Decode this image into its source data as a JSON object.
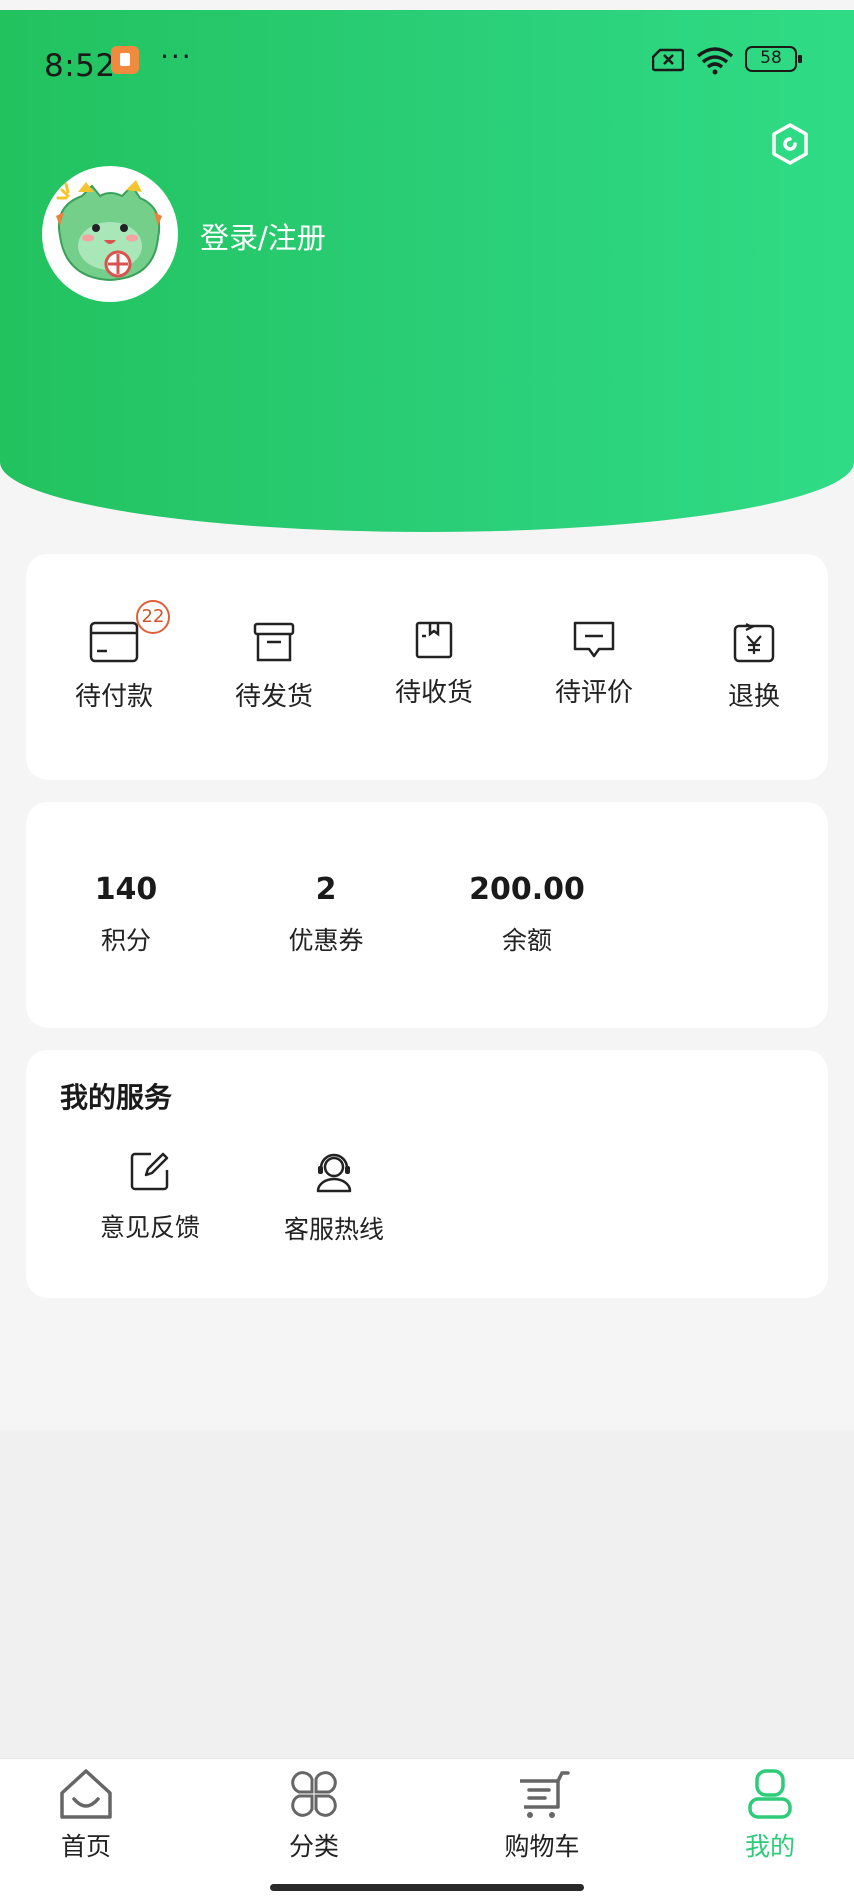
{
  "status_bar": {
    "time": "8:52",
    "battery": "58"
  },
  "header": {
    "login_label": "登录/注册"
  },
  "orders": [
    {
      "label": "待付款",
      "badge": "22",
      "icon": "wallet-card-icon"
    },
    {
      "label": "待发货",
      "icon": "box-icon"
    },
    {
      "label": "待收货",
      "icon": "package-icon"
    },
    {
      "label": "待评价",
      "icon": "comment-icon"
    },
    {
      "label": "退换",
      "icon": "refund-yen-icon"
    }
  ],
  "assets": [
    {
      "value": "140",
      "label": "积分"
    },
    {
      "value": "2",
      "label": "优惠券"
    },
    {
      "value": "200.00",
      "label": "余额"
    }
  ],
  "services": {
    "title": "我的服务",
    "items": [
      {
        "label": "意见反馈",
        "icon": "edit-feedback-icon"
      },
      {
        "label": "客服热线",
        "icon": "customer-service-icon"
      }
    ]
  },
  "tabbar": {
    "items": [
      {
        "label": "首页",
        "icon": "home-icon"
      },
      {
        "label": "分类",
        "icon": "category-icon"
      },
      {
        "label": "购物车",
        "icon": "cart-icon"
      },
      {
        "label": "我的",
        "icon": "profile-icon",
        "active": true
      }
    ],
    "active_color": "#2ecc79"
  },
  "colors": {
    "header_start": "#22c25e",
    "header_end": "#2fdc85",
    "badge": "#e0603a"
  }
}
